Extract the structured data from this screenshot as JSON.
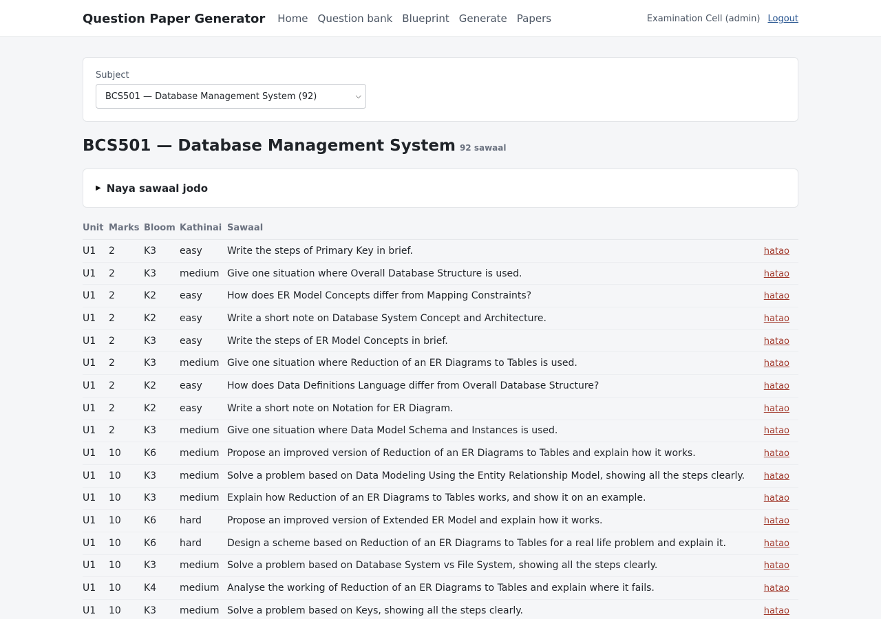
{
  "header": {
    "brand": "Question Paper Generator",
    "nav": [
      "Home",
      "Question bank",
      "Blueprint",
      "Generate",
      "Papers"
    ],
    "user": "Examination Cell (admin)",
    "logout": "Logout"
  },
  "subject_picker": {
    "label": "Subject",
    "selected": "BCS501 — Database Management System (92)"
  },
  "page": {
    "title": "BCS501 — Database Management System",
    "count": "92 sawaal"
  },
  "add_question": {
    "label": "Naya sawaal jodo"
  },
  "table": {
    "columns": [
      "Unit",
      "Marks",
      "Bloom",
      "Kathinai",
      "Sawaal"
    ],
    "action_label": "hatao",
    "rows": [
      [
        "U1",
        "2",
        "K3",
        "easy",
        "Write the steps of Primary Key in brief."
      ],
      [
        "U1",
        "2",
        "K3",
        "medium",
        "Give one situation where Overall Database Structure is used."
      ],
      [
        "U1",
        "2",
        "K2",
        "easy",
        "How does ER Model Concepts differ from Mapping Constraints?"
      ],
      [
        "U1",
        "2",
        "K2",
        "easy",
        "Write a short note on Database System Concept and Architecture."
      ],
      [
        "U1",
        "2",
        "K3",
        "easy",
        "Write the steps of ER Model Concepts in brief."
      ],
      [
        "U1",
        "2",
        "K3",
        "medium",
        "Give one situation where Reduction of an ER Diagrams to Tables is used."
      ],
      [
        "U1",
        "2",
        "K2",
        "easy",
        "How does Data Definitions Language differ from Overall Database Structure?"
      ],
      [
        "U1",
        "2",
        "K2",
        "easy",
        "Write a short note on Notation for ER Diagram."
      ],
      [
        "U1",
        "2",
        "K3",
        "medium",
        "Give one situation where Data Model Schema and Instances is used."
      ],
      [
        "U1",
        "10",
        "K6",
        "medium",
        "Propose an improved version of Reduction of an ER Diagrams to Tables and explain how it works."
      ],
      [
        "U1",
        "10",
        "K3",
        "medium",
        "Solve a problem based on Data Modeling Using the Entity Relationship Model, showing all the steps clearly."
      ],
      [
        "U1",
        "10",
        "K3",
        "medium",
        "Explain how Reduction of an ER Diagrams to Tables works, and show it on an example."
      ],
      [
        "U1",
        "10",
        "K6",
        "hard",
        "Propose an improved version of Extended ER Model and explain how it works."
      ],
      [
        "U1",
        "10",
        "K6",
        "hard",
        "Design a scheme based on Reduction of an ER Diagrams to Tables for a real life problem and explain it."
      ],
      [
        "U1",
        "10",
        "K3",
        "medium",
        "Solve a problem based on Database System vs File System, showing all the steps clearly."
      ],
      [
        "U1",
        "10",
        "K4",
        "medium",
        "Analyse the working of Reduction of an ER Diagrams to Tables and explain where it fails."
      ],
      [
        "U1",
        "10",
        "K3",
        "medium",
        "Solve a problem based on Keys, showing all the steps clearly."
      ]
    ]
  }
}
